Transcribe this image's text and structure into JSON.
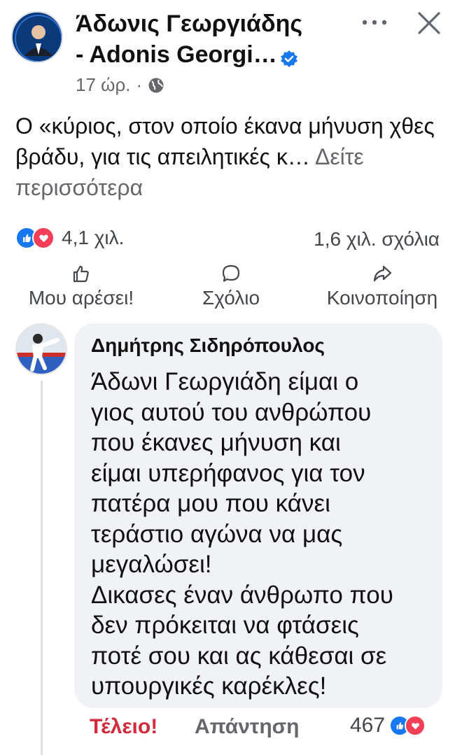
{
  "post": {
    "author_line1": "Άδωνις Γεωργιάδης",
    "author_line2": "- Adonis Georgi…",
    "time": "17 ώρ.",
    "separator": "·",
    "text": "Ο «κύριος, στον οποίο έκανα μήνυση χθες βράδυ, για τις απειλητικές κ…",
    "see_more": "Δείτε περισσότερα",
    "reactions_count": "4,1 χιλ.",
    "comments_count": "1,6 χιλ. σχόλια"
  },
  "actions": {
    "like": "Μου αρέσει!",
    "comment": "Σχόλιο",
    "share": "Κοινοποίηση"
  },
  "comment": {
    "author": "Δημήτρης Σιδηρόπουλος",
    "lines": [
      "Άδωνι Γεωργιάδη είμαι ο",
      "γιος αυτού του ανθρώπου",
      "που έκανες μήνυση και",
      "είμαι υπερήφανος για τον",
      "πατέρα μου  που κάνει",
      "τεράστιο αγώνα να μας",
      "μεγαλώσει!",
      "Δικασες έναν άνθρωπο που",
      "δεν πρόκειται να φτάσεις",
      "ποτέ σου και ας κάθεσαι σε",
      "υπουργικές καρέκλες!"
    ],
    "reaction_label": "Τέλειο!",
    "reply_label": "Απάντηση",
    "reactions_count": "467"
  },
  "icons": {
    "more": "more-horizontal-icon",
    "close": "close-icon",
    "verified": "verified-badge-icon",
    "audience": "globe-icon",
    "like": "thumbs-up-icon",
    "comment": "comment-bubble-icon",
    "share": "share-arrow-icon"
  },
  "colors": {
    "like_blue": "#1877f2",
    "love_red": "#f33e58",
    "reaction_text": "#d22b3c",
    "bubble_bg": "#f0f2f5",
    "muted_text": "#65676b"
  }
}
